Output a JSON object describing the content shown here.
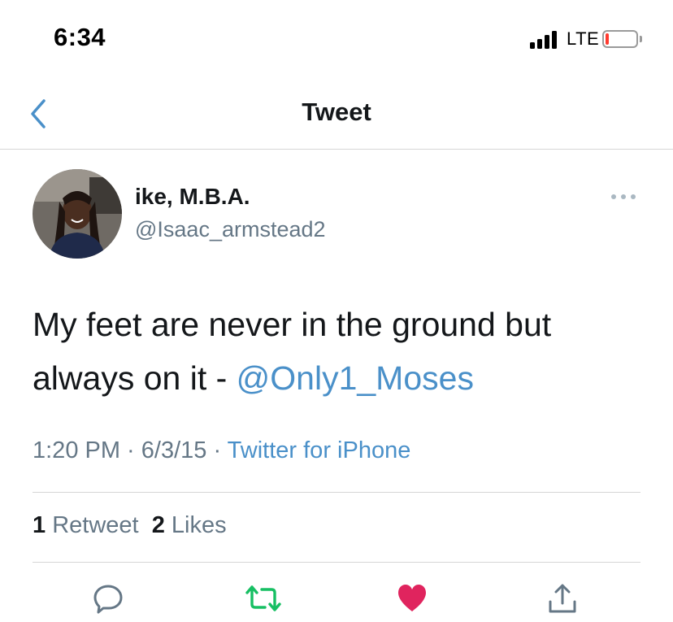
{
  "status_bar": {
    "time": "6:34",
    "network": "LTE",
    "battery_level": 0.12,
    "battery_color": "#ff3b30"
  },
  "nav": {
    "back_icon": "chevron-left-icon",
    "title": "Tweet"
  },
  "tweet": {
    "author": {
      "display_name": "ike, M.B.A.",
      "handle": "@Isaac_armstead2"
    },
    "text": "My feet are never in the ground but always on it - ",
    "mention": "@Only1_Moses",
    "time": "1:20 PM",
    "separator": " · ",
    "date": "6/3/15",
    "source": "Twitter for iPhone"
  },
  "stats": {
    "retweets_count": "1",
    "retweets_label": "Retweet",
    "likes_count": "2",
    "likes_label": "Likes"
  },
  "actions": [
    {
      "name": "reply-icon",
      "color": "#657786"
    },
    {
      "name": "retweet-icon",
      "color": "#17bf63"
    },
    {
      "name": "like-icon",
      "color": "#e0245e"
    },
    {
      "name": "share-icon",
      "color": "#657786"
    }
  ],
  "colors": {
    "accent": "#4a90c9",
    "muted": "#657786",
    "like": "#e0245e",
    "retweet": "#17bf63"
  }
}
